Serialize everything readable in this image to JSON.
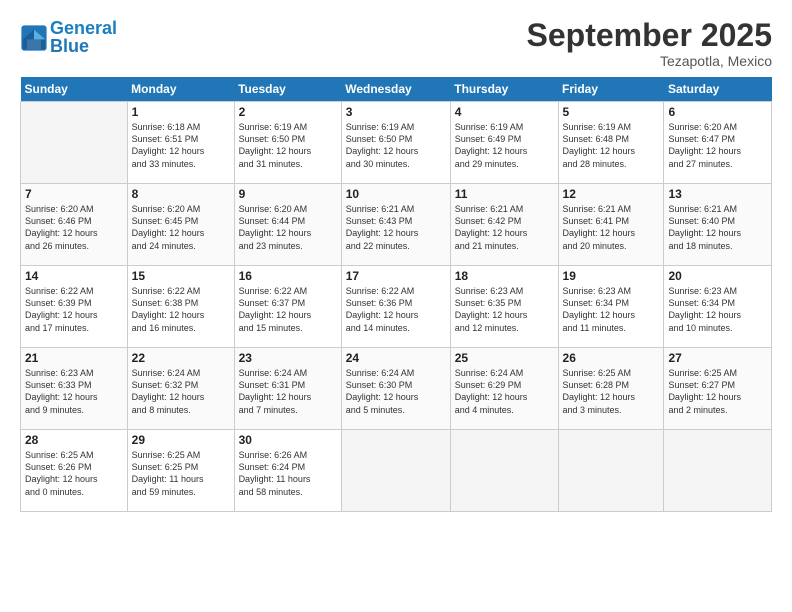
{
  "header": {
    "logo_line1": "General",
    "logo_line2": "Blue",
    "month": "September 2025",
    "location": "Tezapotla, Mexico"
  },
  "days_of_week": [
    "Sunday",
    "Monday",
    "Tuesday",
    "Wednesday",
    "Thursday",
    "Friday",
    "Saturday"
  ],
  "weeks": [
    [
      {
        "day": "",
        "info": ""
      },
      {
        "day": "1",
        "info": "Sunrise: 6:18 AM\nSunset: 6:51 PM\nDaylight: 12 hours\nand 33 minutes."
      },
      {
        "day": "2",
        "info": "Sunrise: 6:19 AM\nSunset: 6:50 PM\nDaylight: 12 hours\nand 31 minutes."
      },
      {
        "day": "3",
        "info": "Sunrise: 6:19 AM\nSunset: 6:50 PM\nDaylight: 12 hours\nand 30 minutes."
      },
      {
        "day": "4",
        "info": "Sunrise: 6:19 AM\nSunset: 6:49 PM\nDaylight: 12 hours\nand 29 minutes."
      },
      {
        "day": "5",
        "info": "Sunrise: 6:19 AM\nSunset: 6:48 PM\nDaylight: 12 hours\nand 28 minutes."
      },
      {
        "day": "6",
        "info": "Sunrise: 6:20 AM\nSunset: 6:47 PM\nDaylight: 12 hours\nand 27 minutes."
      }
    ],
    [
      {
        "day": "7",
        "info": "Sunrise: 6:20 AM\nSunset: 6:46 PM\nDaylight: 12 hours\nand 26 minutes."
      },
      {
        "day": "8",
        "info": "Sunrise: 6:20 AM\nSunset: 6:45 PM\nDaylight: 12 hours\nand 24 minutes."
      },
      {
        "day": "9",
        "info": "Sunrise: 6:20 AM\nSunset: 6:44 PM\nDaylight: 12 hours\nand 23 minutes."
      },
      {
        "day": "10",
        "info": "Sunrise: 6:21 AM\nSunset: 6:43 PM\nDaylight: 12 hours\nand 22 minutes."
      },
      {
        "day": "11",
        "info": "Sunrise: 6:21 AM\nSunset: 6:42 PM\nDaylight: 12 hours\nand 21 minutes."
      },
      {
        "day": "12",
        "info": "Sunrise: 6:21 AM\nSunset: 6:41 PM\nDaylight: 12 hours\nand 20 minutes."
      },
      {
        "day": "13",
        "info": "Sunrise: 6:21 AM\nSunset: 6:40 PM\nDaylight: 12 hours\nand 18 minutes."
      }
    ],
    [
      {
        "day": "14",
        "info": "Sunrise: 6:22 AM\nSunset: 6:39 PM\nDaylight: 12 hours\nand 17 minutes."
      },
      {
        "day": "15",
        "info": "Sunrise: 6:22 AM\nSunset: 6:38 PM\nDaylight: 12 hours\nand 16 minutes."
      },
      {
        "day": "16",
        "info": "Sunrise: 6:22 AM\nSunset: 6:37 PM\nDaylight: 12 hours\nand 15 minutes."
      },
      {
        "day": "17",
        "info": "Sunrise: 6:22 AM\nSunset: 6:36 PM\nDaylight: 12 hours\nand 14 minutes."
      },
      {
        "day": "18",
        "info": "Sunrise: 6:23 AM\nSunset: 6:35 PM\nDaylight: 12 hours\nand 12 minutes."
      },
      {
        "day": "19",
        "info": "Sunrise: 6:23 AM\nSunset: 6:34 PM\nDaylight: 12 hours\nand 11 minutes."
      },
      {
        "day": "20",
        "info": "Sunrise: 6:23 AM\nSunset: 6:34 PM\nDaylight: 12 hours\nand 10 minutes."
      }
    ],
    [
      {
        "day": "21",
        "info": "Sunrise: 6:23 AM\nSunset: 6:33 PM\nDaylight: 12 hours\nand 9 minutes."
      },
      {
        "day": "22",
        "info": "Sunrise: 6:24 AM\nSunset: 6:32 PM\nDaylight: 12 hours\nand 8 minutes."
      },
      {
        "day": "23",
        "info": "Sunrise: 6:24 AM\nSunset: 6:31 PM\nDaylight: 12 hours\nand 7 minutes."
      },
      {
        "day": "24",
        "info": "Sunrise: 6:24 AM\nSunset: 6:30 PM\nDaylight: 12 hours\nand 5 minutes."
      },
      {
        "day": "25",
        "info": "Sunrise: 6:24 AM\nSunset: 6:29 PM\nDaylight: 12 hours\nand 4 minutes."
      },
      {
        "day": "26",
        "info": "Sunrise: 6:25 AM\nSunset: 6:28 PM\nDaylight: 12 hours\nand 3 minutes."
      },
      {
        "day": "27",
        "info": "Sunrise: 6:25 AM\nSunset: 6:27 PM\nDaylight: 12 hours\nand 2 minutes."
      }
    ],
    [
      {
        "day": "28",
        "info": "Sunrise: 6:25 AM\nSunset: 6:26 PM\nDaylight: 12 hours\nand 0 minutes."
      },
      {
        "day": "29",
        "info": "Sunrise: 6:25 AM\nSunset: 6:25 PM\nDaylight: 11 hours\nand 59 minutes."
      },
      {
        "day": "30",
        "info": "Sunrise: 6:26 AM\nSunset: 6:24 PM\nDaylight: 11 hours\nand 58 minutes."
      },
      {
        "day": "",
        "info": ""
      },
      {
        "day": "",
        "info": ""
      },
      {
        "day": "",
        "info": ""
      },
      {
        "day": "",
        "info": ""
      }
    ]
  ]
}
